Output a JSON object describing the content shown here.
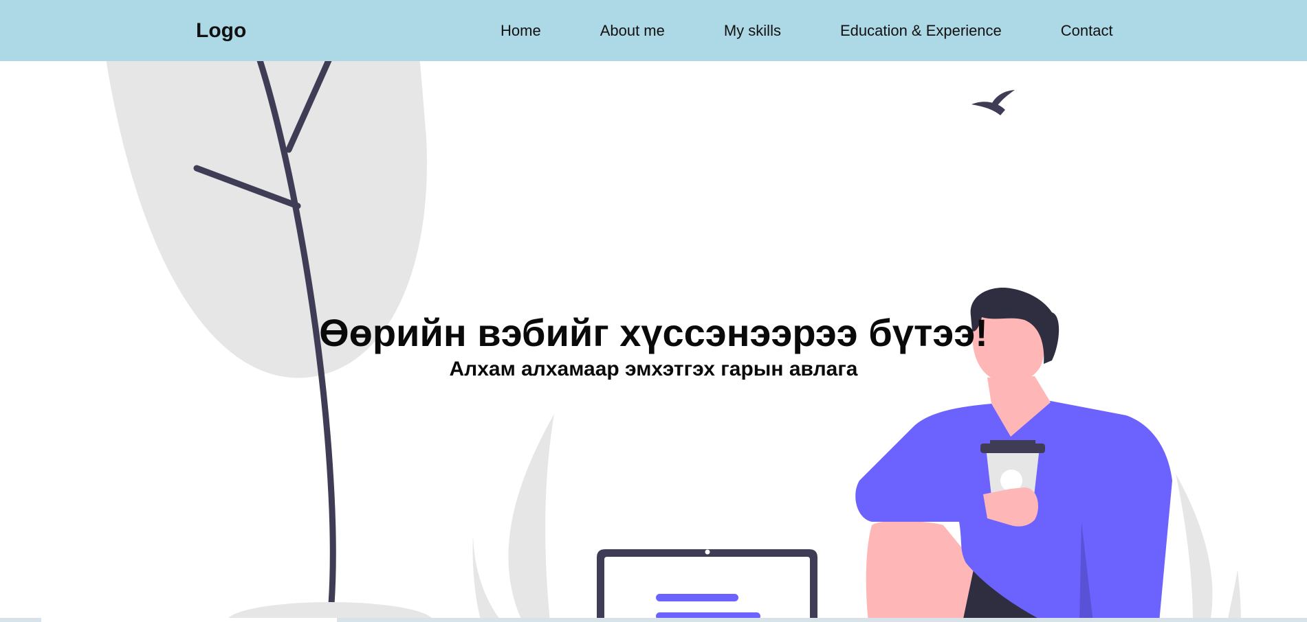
{
  "header": {
    "logo": "Logo",
    "nav": [
      {
        "label": "Home"
      },
      {
        "label": "About me"
      },
      {
        "label": "My skills"
      },
      {
        "label": "Education & Experience"
      },
      {
        "label": "Contact"
      }
    ]
  },
  "hero": {
    "title": "Өөрийн вэбийг хүссэнээрээ бүтээ!",
    "subtitle": "Алхам алхамаар эмхэтгэх гарын авлага"
  },
  "colors": {
    "navbar_bg": "#add8e6",
    "accent_purple": "#6c63ff",
    "dark": "#3f3d56",
    "skin": "#ffb6b6",
    "leaf_gray": "#e6e6e6"
  },
  "icons": {
    "bird": "bird-icon",
    "laptop": "laptop-icon",
    "coffee": "coffee-cup-icon"
  }
}
